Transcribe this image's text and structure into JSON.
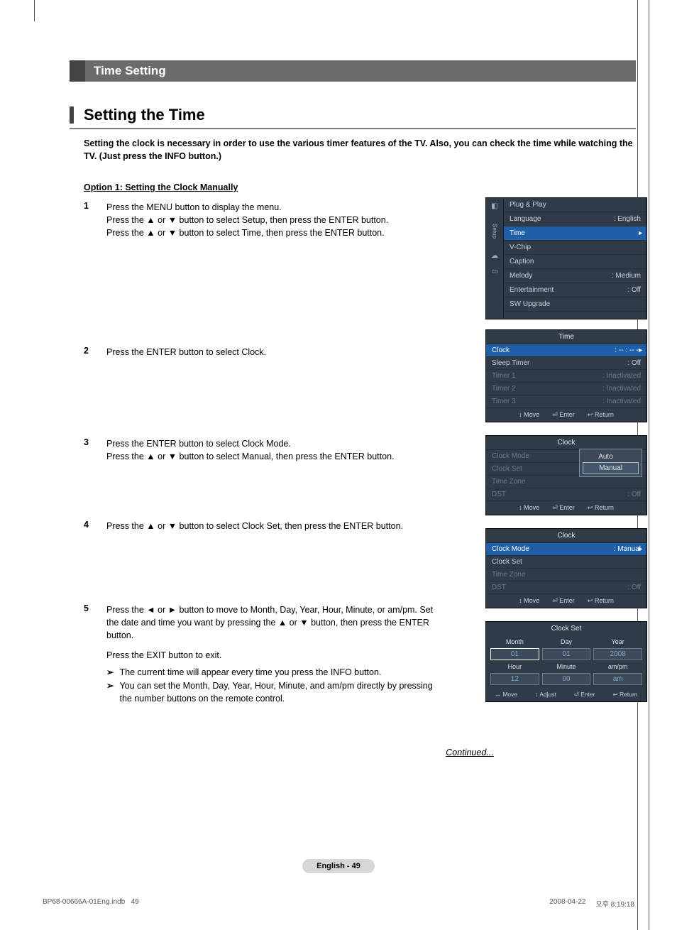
{
  "topic": "Time Setting",
  "section": "Setting the Time",
  "lead": "Setting the clock is necessary in order to use the various timer features of the TV. Also, you can check the time while watching the TV. (Just press the INFO button.)",
  "option1": "Option 1: Setting the Clock Manually",
  "steps": [
    {
      "n": "1",
      "lines": [
        "Press the MENU button to display the menu.",
        "Press the ▲ or ▼ button to select Setup, then press the ENTER button.",
        "Press the ▲ or ▼ button to select Time, then press the ENTER button."
      ]
    },
    {
      "n": "2",
      "lines": [
        "Press the ENTER button to select Clock."
      ]
    },
    {
      "n": "3",
      "lines": [
        "Press the ENTER button to select Clock Mode.",
        "Press the ▲ or ▼ button to select Manual, then press the ENTER button."
      ]
    },
    {
      "n": "4",
      "lines": [
        "Press the ▲ or ▼ button to select Clock Set, then press the ENTER button."
      ]
    },
    {
      "n": "5",
      "lines": [
        "Press the ◄ or ► button to move to Month, Day, Year, Hour, Minute, or am/pm. Set the date and time you want by pressing the ▲ or ▼ button, then press the ENTER button.",
        "",
        "Press the EXIT button to exit."
      ],
      "tips": [
        "The current time will appear every time you press the INFO button.",
        "You can set the Month, Day, Year, Hour, Minute, and am/pm directly by pressing the number buttons on the remote control."
      ]
    }
  ],
  "osd1": {
    "tab": "Setup",
    "items": [
      {
        "label": "Plug & Play",
        "val": ""
      },
      {
        "label": "Language",
        "val": ": English"
      },
      {
        "label": "Time",
        "val": "",
        "hl": true
      },
      {
        "label": "V-Chip",
        "val": ""
      },
      {
        "label": "Caption",
        "val": ""
      },
      {
        "label": "Melody",
        "val": ": Medium"
      },
      {
        "label": "Entertainment",
        "val": ": Off"
      },
      {
        "label": "SW Upgrade",
        "val": ""
      }
    ]
  },
  "osd2": {
    "title": "Time",
    "items": [
      {
        "label": "Clock",
        "val": ": -- : -- --",
        "hl": true
      },
      {
        "label": "Sleep Timer",
        "val": ": Off"
      },
      {
        "label": "Timer 1",
        "val": ": Inactivated",
        "dim": true
      },
      {
        "label": "Timer 2",
        "val": ": Inactivated",
        "dim": true
      },
      {
        "label": "Timer 3",
        "val": ": Inactivated",
        "dim": true
      }
    ],
    "foot": [
      "Move",
      "Enter",
      "Return"
    ]
  },
  "osd3": {
    "title": "Clock",
    "items": [
      {
        "label": "Clock Mode",
        "val": ""
      },
      {
        "label": "Clock Set",
        "val": ""
      },
      {
        "label": "Time Zone",
        "val": ""
      },
      {
        "label": "DST",
        "val": ": Off"
      }
    ],
    "popup": [
      "Auto",
      "Manual"
    ],
    "foot": [
      "Move",
      "Enter",
      "Return"
    ]
  },
  "osd4": {
    "title": "Clock",
    "items": [
      {
        "label": "Clock Mode",
        "val": ": Manual",
        "hl": true
      },
      {
        "label": "Clock Set",
        "val": ""
      },
      {
        "label": "Time Zone",
        "val": "",
        "dim": true
      },
      {
        "label": "DST",
        "val": ": Off",
        "dim": true
      }
    ],
    "foot": [
      "Move",
      "Enter",
      "Return"
    ]
  },
  "osd5": {
    "title": "Clock Set",
    "cols1": [
      "Month",
      "Day",
      "Year"
    ],
    "vals1": [
      "01",
      "01",
      "2008"
    ],
    "cols2": [
      "Hour",
      "Minute",
      "am/pm"
    ],
    "vals2": [
      "12",
      "00",
      "am"
    ],
    "foot": [
      "Move",
      "Adjust",
      "Enter",
      "Return"
    ]
  },
  "glyph": {
    "move": "↕",
    "enter": "⏎",
    "return": "↩",
    "moveh": "↔"
  },
  "continued": "Continued...",
  "footer": "English - 49",
  "meta": {
    "file": "BP68-00666A-01Eng.indb",
    "page": "49",
    "date": "2008-04-22",
    "time": "오후 8:19:18"
  }
}
